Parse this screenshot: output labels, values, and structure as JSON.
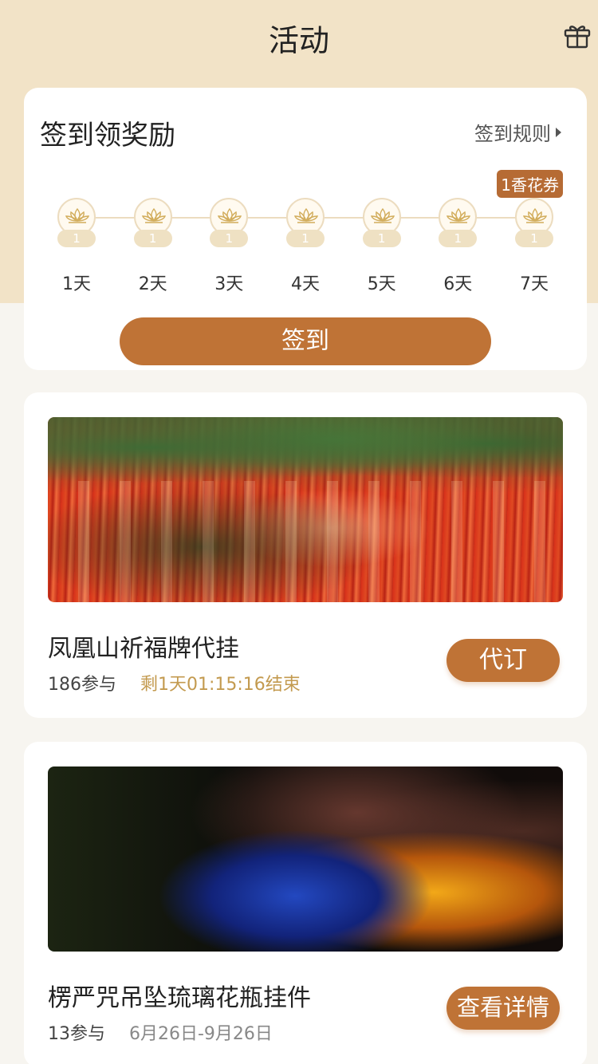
{
  "header": {
    "title": "活动",
    "gift_icon": "gift-icon"
  },
  "signin": {
    "title": "签到领奖励",
    "rules_label": "签到规则",
    "reward_badge": "1香花券",
    "days": [
      {
        "label": "1天",
        "reward": "1"
      },
      {
        "label": "2天",
        "reward": "1"
      },
      {
        "label": "3天",
        "reward": "1"
      },
      {
        "label": "4天",
        "reward": "1"
      },
      {
        "label": "5天",
        "reward": "1"
      },
      {
        "label": "6天",
        "reward": "1"
      },
      {
        "label": "7天",
        "reward": "1"
      }
    ],
    "button_label": "签到"
  },
  "activities": [
    {
      "title": "凤凰山祈福牌代挂",
      "participants": "186参与",
      "time_info": "剩1天01:15:16结束",
      "button_label": "代订"
    },
    {
      "title": "楞严咒吊坠琉璃花瓶挂件",
      "participants": "13参与",
      "time_info": "6月26日-9月26日",
      "button_label": "查看详情"
    }
  ],
  "colors": {
    "accent": "#bf7336",
    "header_bg": "#f2e3c7",
    "countdown": "#c39a4f"
  }
}
